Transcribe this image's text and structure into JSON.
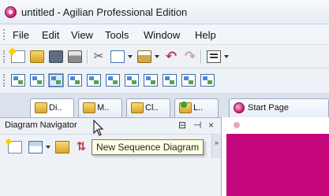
{
  "window": {
    "title": "untitled - Agilian Professional Edition"
  },
  "menubar": {
    "items": [
      "File",
      "Edit",
      "View",
      "Tools",
      "Window",
      "Help"
    ]
  },
  "toolbar1": {
    "icons": [
      "new-project-icon",
      "open-project-icon",
      "save-project-icon",
      "print-icon",
      "cut-icon",
      "copy-icon",
      "paste-icon",
      "undo-icon",
      "redo-icon",
      "layout-icon"
    ]
  },
  "toolbar2": {
    "icons": [
      "new-class-diagram-icon",
      "new-use-case-diagram-icon",
      "new-sequence-diagram-icon",
      "new-communication-diagram-icon",
      "new-state-machine-diagram-icon",
      "new-activity-diagram-icon",
      "new-component-diagram-icon",
      "new-deployment-diagram-icon",
      "new-package-diagram-icon",
      "new-object-diagram-icon",
      "new-composite-structure-diagram-icon"
    ]
  },
  "tabs": [
    {
      "label": "Di..",
      "icon": "diagram-navigator-tab-icon",
      "selected": true
    },
    {
      "label": "M..",
      "icon": "model-tree-tab-icon",
      "selected": false
    },
    {
      "label": "Cl..",
      "icon": "class-repository-tab-icon",
      "selected": false
    },
    {
      "label": "L..",
      "icon": "logical-view-tab-icon",
      "selected": false
    },
    {
      "label": "Start Page",
      "icon": "start-page-icon",
      "selected": false
    }
  ],
  "navigator": {
    "title": "Diagram Navigator",
    "controls": {
      "restore": "⊟",
      "pin": "⊣",
      "close": "×"
    },
    "toolbar_more": "»"
  },
  "tooltip": {
    "text": "New Sequence Diagram"
  },
  "colors": {
    "canvas_accent": "#c4067b",
    "tooltip_bg": "#ffffe1"
  }
}
